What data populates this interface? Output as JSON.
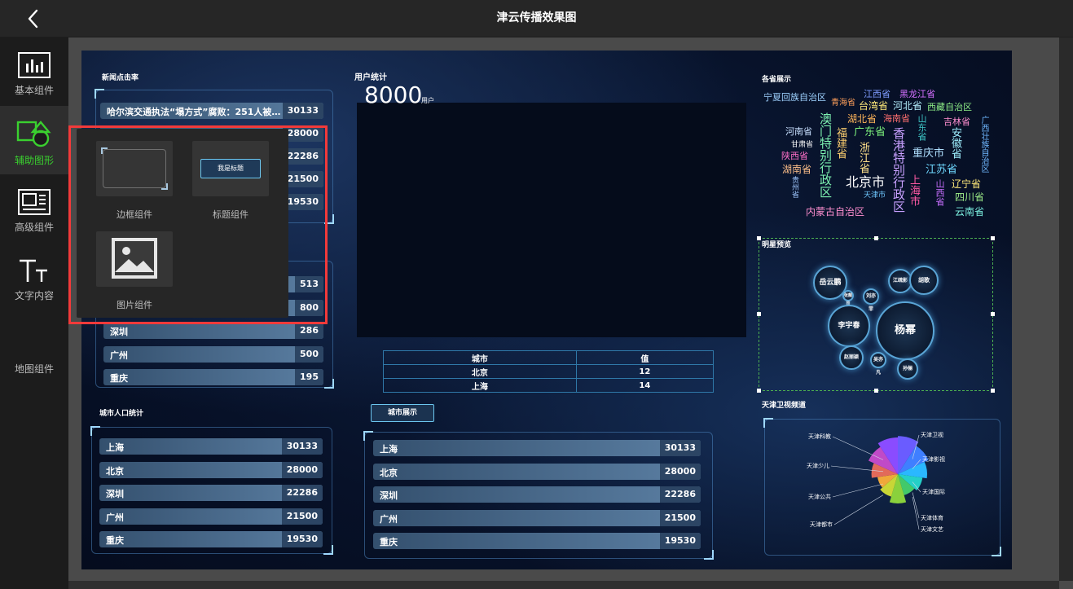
{
  "window": {
    "title": "津云传播效果图"
  },
  "sidebar": {
    "items": [
      {
        "label": "基本组件",
        "icon": "bar-chart-icon"
      },
      {
        "label": "辅助图形",
        "icon": "shapes-icon",
        "active": true
      },
      {
        "label": "高级组件",
        "icon": "layout-icon"
      },
      {
        "label": "文字内容",
        "icon": "text-icon"
      },
      {
        "label": "地图组件",
        "icon": "map-icon"
      }
    ]
  },
  "popup": {
    "items": [
      {
        "label": "边框组件",
        "icon": "border-frame-icon"
      },
      {
        "label": "标题组件",
        "icon": "title-badge-icon",
        "preview_text": "我是标题"
      },
      {
        "label": "图片组件",
        "icon": "image-icon"
      }
    ]
  },
  "canvas": {
    "news": {
      "title": "新闻点击率",
      "rows": [
        {
          "name": "哈尔滨交通执法“塌方式”腐败：251人被查...",
          "value": "30133"
        },
        {
          "name": "",
          "value": "28000"
        },
        {
          "name": "",
          "value": "22286"
        },
        {
          "name": "",
          "value": "21500"
        },
        {
          "name": "",
          "value": "19530"
        }
      ]
    },
    "mid_left": {
      "rows": [
        {
          "name": "",
          "value": "513"
        },
        {
          "name": "",
          "value": "800"
        },
        {
          "name": "深圳",
          "value": "286"
        },
        {
          "name": "广州",
          "value": "500"
        },
        {
          "name": "重庆",
          "value": "195"
        }
      ]
    },
    "population": {
      "title": "城市人口统计",
      "rows": [
        {
          "name": "上海",
          "value": "30133"
        },
        {
          "name": "北京",
          "value": "28000"
        },
        {
          "name": "深圳",
          "value": "22286"
        },
        {
          "name": "广州",
          "value": "21500"
        },
        {
          "name": "重庆",
          "value": "19530"
        }
      ]
    },
    "users": {
      "title": "用户统计",
      "number": "8000",
      "unit": "用户"
    },
    "city_table": {
      "headers": [
        "城市",
        "值"
      ],
      "rows": [
        [
          "北京",
          "12"
        ],
        [
          "上海",
          "14"
        ]
      ]
    },
    "city_show": {
      "button": "城市展示",
      "rows": [
        {
          "name": "上海",
          "value": "30133"
        },
        {
          "name": "北京",
          "value": "28000"
        },
        {
          "name": "深圳",
          "value": "22286"
        },
        {
          "name": "广州",
          "value": "21500"
        },
        {
          "name": "重庆",
          "value": "19530"
        }
      ]
    },
    "provinces": {
      "title": "各省展示",
      "words": [
        {
          "text": "宁夏回族自治区",
          "color": "#9fd2ff"
        },
        {
          "text": "青海省",
          "color": "#ff9f5a"
        },
        {
          "text": "江西省",
          "color": "#7f9cff"
        },
        {
          "text": "黑龙江省",
          "color": "#d36fff"
        },
        {
          "text": "台湾省",
          "color": "#ffe97a"
        },
        {
          "text": "河北省",
          "color": "#b6f0ff"
        },
        {
          "text": "西藏自治区",
          "color": "#8ff088"
        },
        {
          "text": "湖北省",
          "color": "#ffb65a"
        },
        {
          "text": "海南省",
          "color": "#ff6f6f"
        },
        {
          "text": "山东省",
          "color": "#3ec8c8"
        },
        {
          "text": "吉林省",
          "color": "#ff8fd0"
        },
        {
          "text": "广西壮族自治区",
          "color": "#6fb8ff"
        },
        {
          "text": "河南省",
          "color": "#c8e0ff"
        },
        {
          "text": "澳门特别行政区",
          "color": "#7cf0b0"
        },
        {
          "text": "福建省",
          "color": "#ffd06f"
        },
        {
          "text": "广东省",
          "color": "#7cf07c"
        },
        {
          "text": "香港特别行政区",
          "color": "#c8a0ff"
        },
        {
          "text": "安徽省",
          "color": "#9ff0ff"
        },
        {
          "text": "甘肃省",
          "color": "#ffffff"
        },
        {
          "text": "浙江省",
          "color": "#ffe08a"
        },
        {
          "text": "重庆市",
          "color": "#b0e0ff"
        },
        {
          "text": "陕西省",
          "color": "#ff6fc8"
        },
        {
          "text": "江苏省",
          "color": "#6fd8ff"
        },
        {
          "text": "湖南省",
          "color": "#ffc08a"
        },
        {
          "text": "上海市",
          "color": "#ff5aa5"
        },
        {
          "text": "山西省",
          "color": "#c86fff"
        },
        {
          "text": "辽宁省",
          "color": "#ffe97a"
        },
        {
          "text": "贵州省",
          "color": "#a0c8ff"
        },
        {
          "text": "北京市",
          "color": "#ffffff"
        },
        {
          "text": "天津市",
          "color": "#6fc8ff"
        },
        {
          "text": "四川省",
          "color": "#9ff08a"
        },
        {
          "text": "内蒙古自治区",
          "color": "#ff8fd0"
        },
        {
          "text": "云南省",
          "color": "#7cf0e0"
        }
      ]
    },
    "stars": {
      "title": "明星预览",
      "names": [
        "岳云鹏",
        "刘亦菲",
        "江疏影",
        "胡歌",
        "张靓颖",
        "李宇春",
        "杨幂",
        "赵丽颖",
        "吴亦凡",
        "孙俪"
      ]
    },
    "tv": {
      "title": "天津卫视频道",
      "labels": [
        "天津科教",
        "天津卫视",
        "天津少儿",
        "天津影视",
        "天津公共",
        "天津国际",
        "天津都市",
        "天津体育",
        "天津文艺"
      ]
    }
  },
  "colors": {
    "accent": "#3ad02f",
    "highlight": "#f23a3a"
  }
}
